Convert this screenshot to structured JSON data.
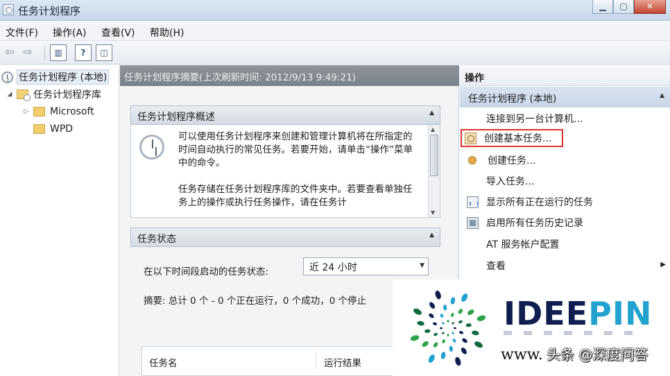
{
  "window": {
    "title": "任务计划程序",
    "controls": {
      "minimize": "▁",
      "maximize": "▢",
      "close": "✕"
    }
  },
  "menubar": {
    "items": [
      "文件(F)",
      "操作(A)",
      "查看(V)",
      "帮助(H)"
    ]
  },
  "toolbar": {
    "buttons": [
      {
        "name": "back-arrow-icon",
        "glyph": "⇦"
      },
      {
        "name": "forward-arrow-icon",
        "glyph": "⇨"
      },
      {
        "name": "console-tree-icon",
        "glyph": "▥"
      },
      {
        "name": "help-icon",
        "glyph": "?"
      },
      {
        "name": "show-hide-pane-icon",
        "glyph": "◫"
      }
    ]
  },
  "tree": {
    "root": "任务计划程序 (本地)",
    "library": "任务计划程序库",
    "folders": [
      "Microsoft",
      "WPD"
    ],
    "expanded_glyph": "◢",
    "collapsed_glyph": "▷"
  },
  "middle": {
    "header": "任务计划程序摘要(上次刷新时间: 2012/9/13 9:49:21)",
    "overview": {
      "title": "任务计划程序概述",
      "paragraphs": [
        "可以使用任务计划程序来创建和管理计算机将在所指定的时间自动执行的常见任务。若要开始，请单击“操作”菜单中的命令。",
        "任务存储在任务计划程序库的文件夹中。若要查看单独任务上的操作或执行任务操作，请在任务计"
      ]
    },
    "status": {
      "title": "任务状态",
      "period_label": "在以下时间段启动的任务状态:",
      "period_value": "近 24 小时",
      "summary": "摘要: 总计 0 个 - 0 个正在运行，0 个成功，0 个停止"
    },
    "table_headers": [
      "任务名",
      "运行结果"
    ],
    "collapse_glyph": "▲",
    "dropdown_glyph": "▼"
  },
  "actions": {
    "header": "操作",
    "group": "任务计划程序 (本地)",
    "items": [
      "连接到另一台计算机...",
      "创建基本任务...",
      "创建任务...",
      "导入任务...",
      "显示所有正在运行的任务",
      "启用所有任务历史记录",
      "AT 服务帐户配置",
      "查看"
    ],
    "submenu_glyph": "▶"
  },
  "watermark": {
    "brand": "IDEEPIN",
    "url": "www.",
    "source": "头条 @深度问答",
    "colors": {
      "navy": "#0f1e4e",
      "cyan": "#22a3cf",
      "green": "#2fa44a",
      "dark_green": "#0f6b3f"
    }
  }
}
